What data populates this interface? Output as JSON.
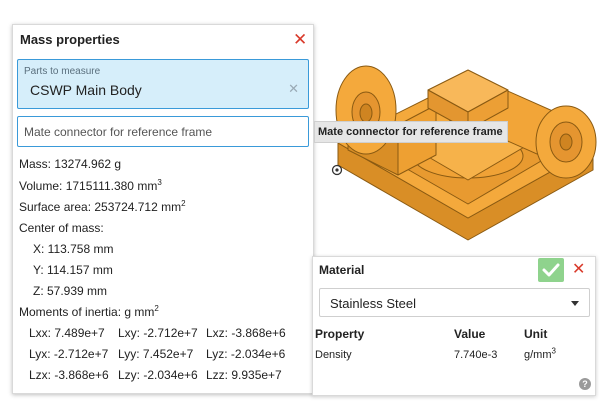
{
  "mass_panel": {
    "title": "Mass properties",
    "parts_label": "Parts to measure",
    "parts_value": "CSWP Main Body",
    "mate_placeholder": "Mate connector for reference frame",
    "mass": "Mass: 13274.962 g",
    "volume": "Volume: 1715111.380 mm",
    "volume_exp": "3",
    "surface_area": "Surface area: 253724.712 mm",
    "surface_exp": "2",
    "center_label": "Center of mass:",
    "cx": "X: 113.758 mm",
    "cy": "Y: 114.157 mm",
    "cz": "Z: 57.939 mm",
    "inertia_label": "Moments of inertia: g mm",
    "inertia_exp": "2",
    "inertia": [
      [
        "Lxx: 7.489e+7",
        "Lxy: -2.712e+7",
        "Lxz: -3.868e+6"
      ],
      [
        "Lyx: -2.712e+7",
        "Lyy: 7.452e+7",
        "Lyz: -2.034e+6"
      ],
      [
        "Lzx: -3.868e+6",
        "Lzy: -2.034e+6",
        "Lzz: 9.935e+7"
      ]
    ]
  },
  "tooltip": {
    "text": "Mate connector for reference frame"
  },
  "material_panel": {
    "title": "Material",
    "selected": "Stainless Steel",
    "headers": {
      "property": "Property",
      "value": "Value",
      "unit": "Unit"
    },
    "row": {
      "property": "Density",
      "value": "7.740e-3",
      "unit": "g/mm",
      "unit_exp": "3"
    },
    "help": "?"
  },
  "icons": {
    "close": "close-icon",
    "clear": "clear-icon",
    "confirm": "check-icon",
    "dropdown": "chevron-down-icon",
    "help": "help-icon",
    "origin": "origin-icon"
  },
  "colors": {
    "accent": "#3a9ad9",
    "selection_fill": "#d6eefa",
    "close": "#d93a2b",
    "confirm": "#8fd38d",
    "model": "#f4a93c"
  }
}
